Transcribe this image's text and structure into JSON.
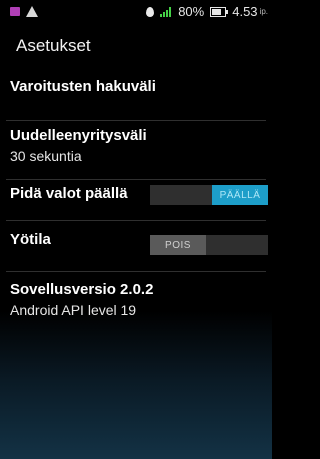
{
  "status_bar": {
    "battery_text": "80%",
    "time_text": "4.53",
    "time_suffix": "ip.",
    "icons": [
      "notification-app-icon",
      "warning-icon",
      "location-pin-icon",
      "signal-icon",
      "battery-icon"
    ],
    "colors": {
      "app_icon": "#b03fb6",
      "signal": "#44d046"
    }
  },
  "action_bar": {
    "title": "Asetukset"
  },
  "settings": [
    {
      "title": "Varoitusten hakuväli",
      "summary": ""
    },
    {
      "title": "Uudelleenyritysväli",
      "summary": "30 sekuntia"
    },
    {
      "title": "Pidä valot päällä",
      "toggle": {
        "state": "on",
        "label": "PÄÄLLÄ"
      }
    },
    {
      "title": "Yötila",
      "toggle": {
        "state": "off",
        "label": "POIS"
      }
    },
    {
      "title": "Sovellusversio 2.0.2",
      "summary": "Android API level 19"
    }
  ],
  "colors": {
    "accent": "#1d9ec9",
    "toggle_track": "#2f2f2f",
    "toggle_off": "#5a5a5a"
  }
}
